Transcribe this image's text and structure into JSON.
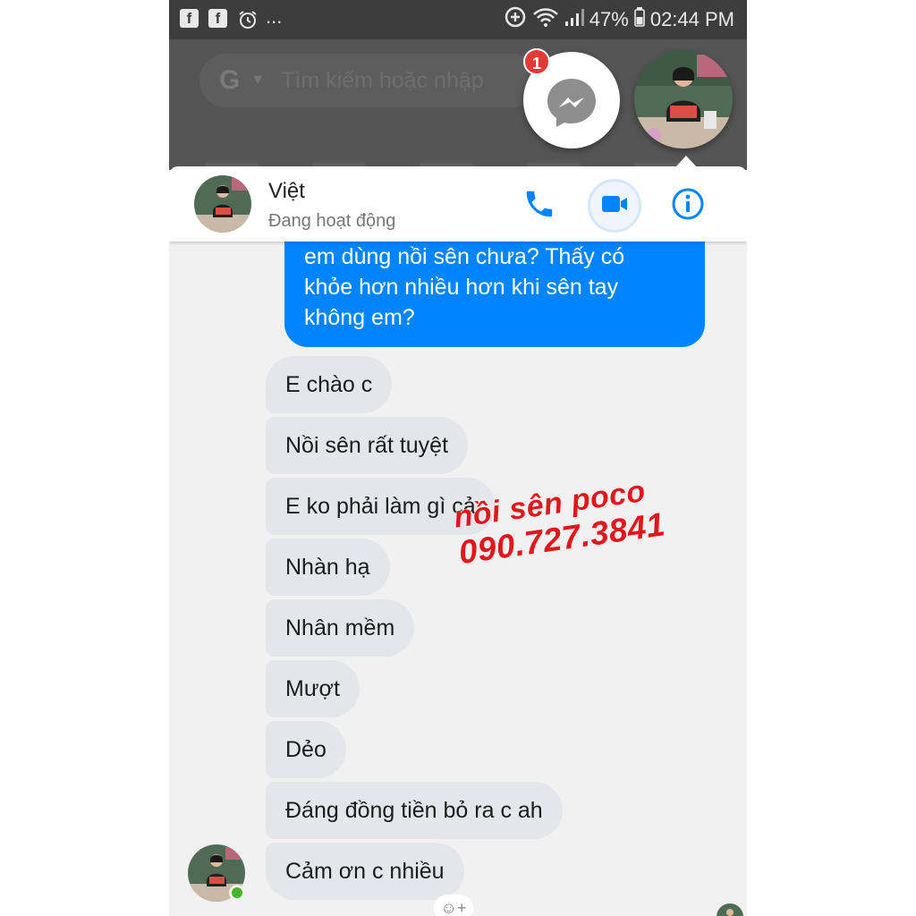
{
  "status_bar": {
    "notif_icons": [
      "facebook-icon",
      "facebook-icon",
      "alarm-icon"
    ],
    "more": "...",
    "battery": "47%",
    "time": "02:44 PM"
  },
  "browser": {
    "search_placeholder": "Tìm kiếm hoặc nhập"
  },
  "chat_head": {
    "badge_count": "1"
  },
  "conversation": {
    "contact_name": "Việt",
    "contact_status": "Đang hoạt động"
  },
  "messages": {
    "sent": {
      "lines": [
        "em dùng nồi sên chưa? Thấy có",
        "khỏe hơn nhiều hơn khi sên tay",
        "không em?"
      ]
    },
    "received": [
      "E chào c",
      "Nồi sên rất tuyệt",
      "E ko phải làm gì cả",
      "Nhàn hạ",
      "Nhân mềm",
      "Mượt",
      "Dẻo",
      "Đáng đồng tiền bỏ ra c ah",
      "Cảm ơn c nhiều"
    ]
  },
  "watermark": {
    "line1": "nồi sên poco",
    "line2": "090.727.3841"
  },
  "colors": {
    "messenger_blue": "#0084ff",
    "incoming_bubble": "#e4e6eb",
    "watermark_red": "#e3171b"
  }
}
